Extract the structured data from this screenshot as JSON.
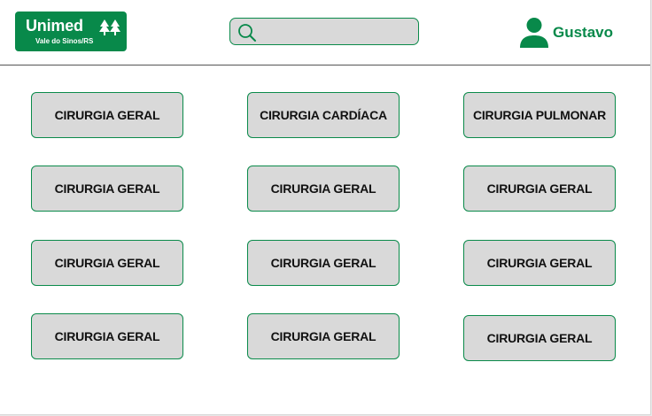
{
  "header": {
    "logo": {
      "title": "Unimed",
      "subtitle": "Vale do Sinos/RS",
      "brand_color": "#08894a",
      "mark_icon": "unimed-trees-icon"
    },
    "search": {
      "placeholder": "",
      "value": "",
      "icon": "search-icon"
    },
    "user": {
      "name": "Gustavo",
      "icon": "user-icon"
    }
  },
  "specialties": [
    {
      "label": "CIRURGIA GERAL"
    },
    {
      "label": "CIRURGIA CARDÍACA"
    },
    {
      "label": "CIRURGIA PULMONAR"
    },
    {
      "label": "CIRURGIA GERAL"
    },
    {
      "label": "CIRURGIA GERAL"
    },
    {
      "label": "CIRURGIA GERAL"
    },
    {
      "label": "CIRURGIA GERAL"
    },
    {
      "label": "CIRURGIA GERAL"
    },
    {
      "label": "CIRURGIA GERAL"
    },
    {
      "label": "CIRURGIA GERAL"
    },
    {
      "label": "CIRURGIA GERAL"
    },
    {
      "label": "CIRURGIA GERAL"
    }
  ],
  "colors": {
    "accent": "#08894a",
    "card_bg": "#d9d9d9",
    "divider": "#555555"
  }
}
